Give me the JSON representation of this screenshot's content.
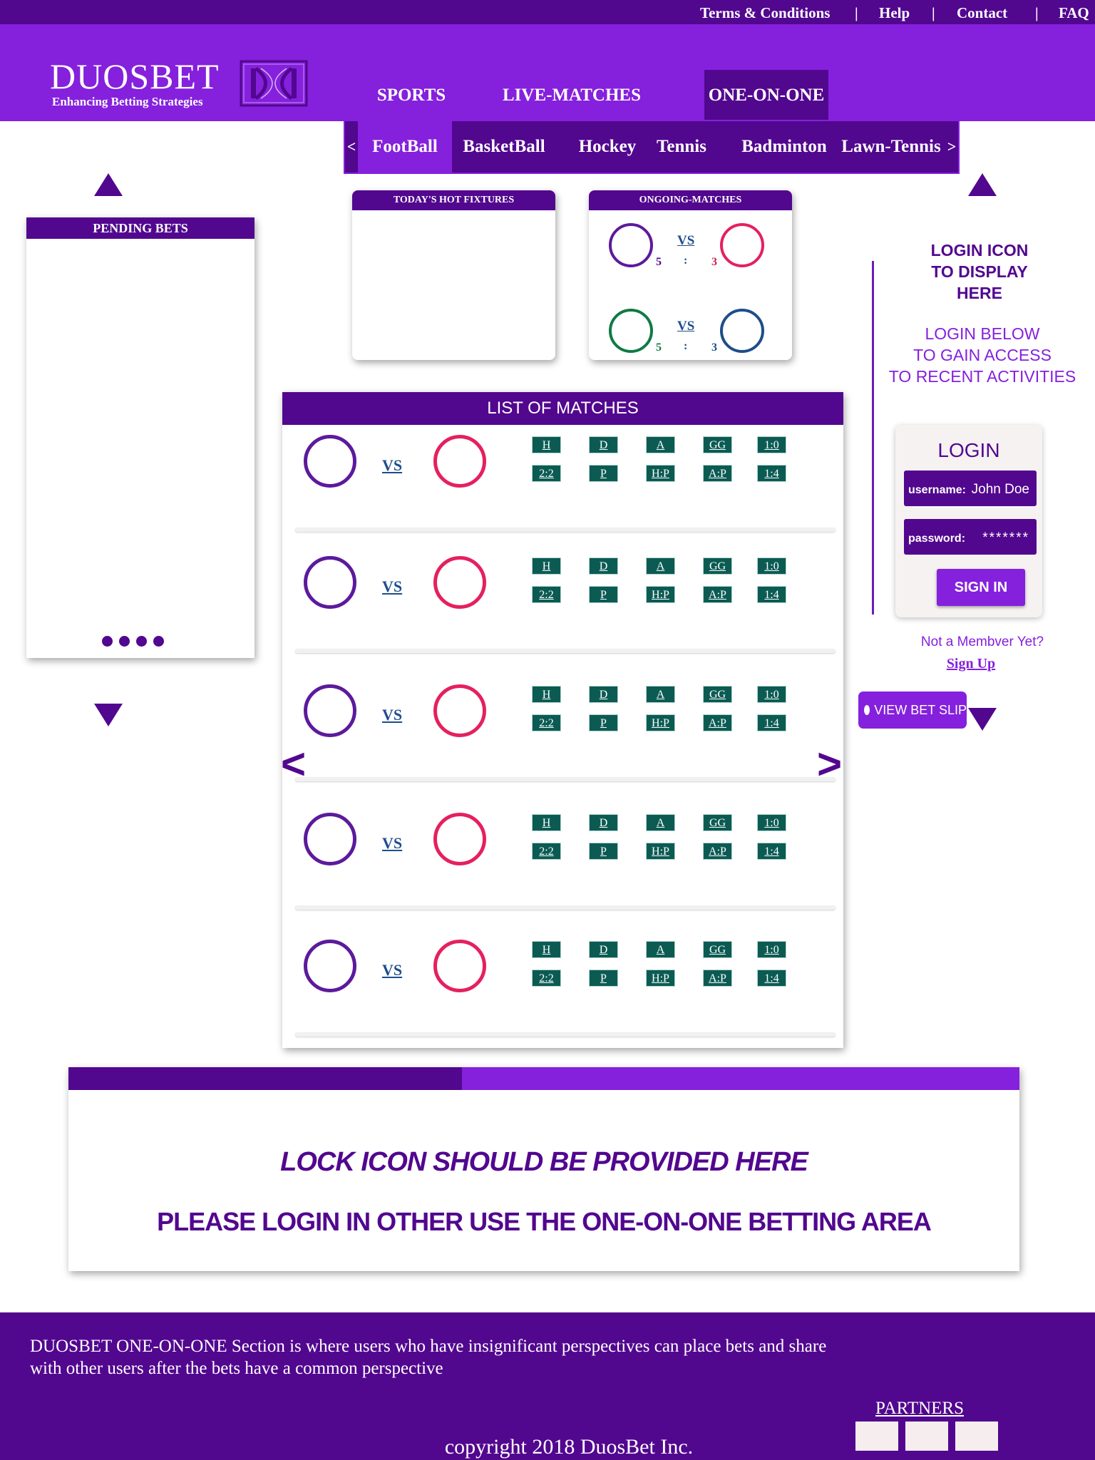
{
  "topbar": {
    "links": [
      "Terms & Conditions",
      "Help",
      "Contact",
      "FAQ"
    ],
    "separator": "|"
  },
  "header": {
    "brand": "DUOSBET",
    "tagline": "Enhancing Betting Strategies",
    "nav": [
      "SPORTS",
      "LIVE-MATCHES",
      "ONE-ON-ONE"
    ],
    "active_nav": "ONE-ON-ONE"
  },
  "sports_bar": {
    "prev": "<",
    "next": ">",
    "items": [
      "FootBall",
      "BasketBall",
      "Hockey",
      "Tennis",
      "Badminton",
      "Lawn-Tennis"
    ],
    "active": "FootBall"
  },
  "pending_bets": {
    "title": "PENDING BETS"
  },
  "hot_fixtures": {
    "title": "TODAY'S HOT FIXTURES"
  },
  "ongoing": {
    "title": "ONGOING-MATCHES",
    "matches": [
      {
        "vs": "VS",
        "colon": ":",
        "home_score": "5",
        "away_score": "3"
      },
      {
        "vs": "VS",
        "colon": ":",
        "home_score": "5",
        "away_score": "3"
      }
    ]
  },
  "matches_list": {
    "title": "LIST OF MATCHES",
    "vs": "VS",
    "odds_row1": [
      "H",
      "D",
      "A",
      "GG",
      "1:0"
    ],
    "odds_row2": [
      "2:2",
      "P",
      "H:P",
      "A:P",
      "1:4"
    ],
    "prev": "<",
    "next": ">"
  },
  "login_side": {
    "icon_note": [
      "LOGIN ICON",
      "TO DISPLAY",
      "HERE"
    ],
    "access_note": [
      "LOGIN BELOW",
      "TO GAIN ACCESS",
      "TO RECENT ACTIVITIES"
    ],
    "login_title": "LOGIN",
    "username_label": "username:",
    "username_value": "John Doe",
    "password_label": "password:",
    "password_value": "*******",
    "signin": "SIGN IN",
    "not_member": "Not a Membver Yet?",
    "signup": "Sign Up",
    "view_bet_slip": "VIEW BET SLIP"
  },
  "lock_panel": {
    "note": "LOCK ICON SHOULD BE PROVIDED HERE",
    "message": "PLEASE LOGIN IN OTHER USE THE ONE-ON-ONE BETTING AREA"
  },
  "footer": {
    "description_line1": "DUOSBET ONE-ON-ONE Section is where users who have insignificant perspectives can place bets and share",
    "description_line2": "with other users after the bets have a common perspective",
    "partners": "PARTNERS",
    "copyright": "copyright 2018 DuosBet Inc."
  },
  "colors": {
    "dark_purple": "#52078f",
    "purple": "#8520dd",
    "teal": "#0b5b53",
    "home_ring": "#5c1a9c",
    "away_ring": "#e5205f",
    "green_ring": "#0f7a45",
    "blue_ring": "#1d4e89"
  }
}
